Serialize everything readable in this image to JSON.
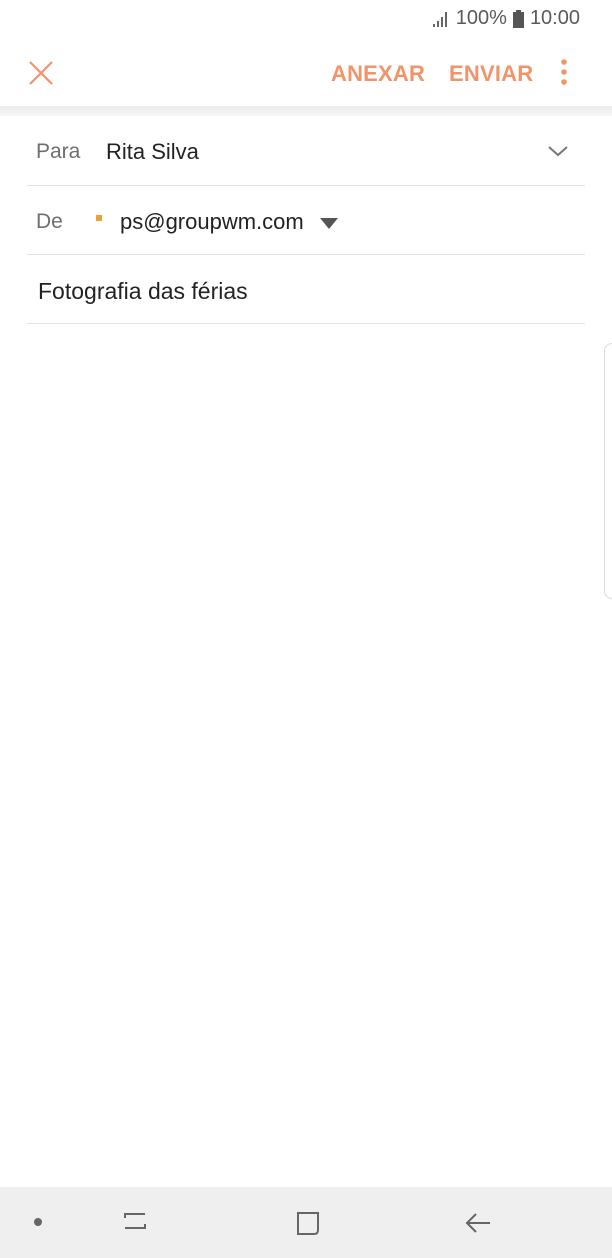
{
  "status_bar": {
    "battery_percent": "100%",
    "time": "10:00",
    "icons": [
      "signal-icon",
      "battery-icon"
    ]
  },
  "toolbar": {
    "close_icon": "close-icon",
    "attach_label": "ANEXAR",
    "send_label": "ENVIAR",
    "more_icon": "more-vertical-icon",
    "accent_color": "#f2946a"
  },
  "compose": {
    "to": {
      "label": "Para",
      "value": "Rita Silva",
      "expand_icon": "chevron-down-icon"
    },
    "from": {
      "label": "De",
      "value": "ps@groupwm.com",
      "account_color": "#e3a53b",
      "dropdown_icon": "caret-down-icon"
    },
    "subject": {
      "value": "Fotografia das férias"
    },
    "body": {
      "value": ""
    }
  },
  "navigation_bar": {
    "icons": [
      "indicator-dot-icon",
      "recent-apps-icon",
      "home-icon",
      "back-icon"
    ]
  }
}
